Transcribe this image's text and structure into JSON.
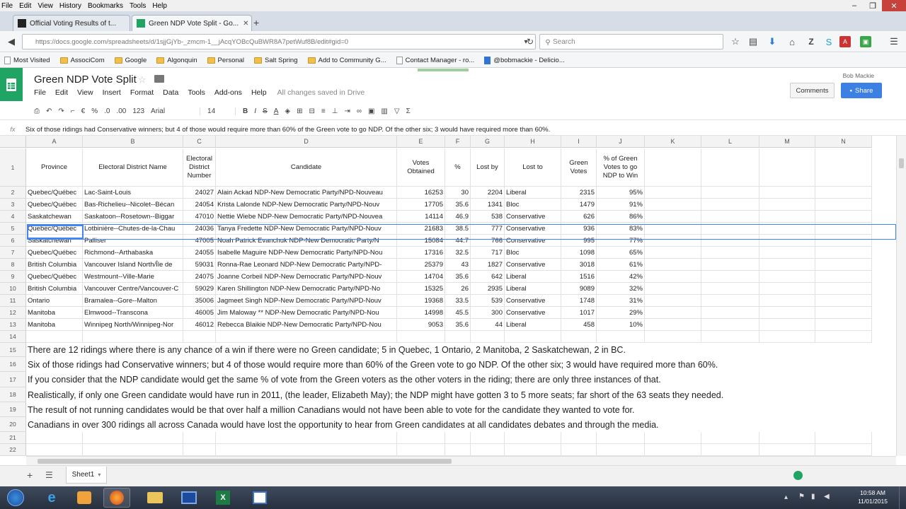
{
  "browser": {
    "menu": [
      "File",
      "Edit",
      "View",
      "History",
      "Bookmarks",
      "Tools",
      "Help"
    ],
    "tabs": [
      {
        "label": "Official Voting Results of t...",
        "active": false
      },
      {
        "label": "Green NDP Vote Split - Go...",
        "active": true
      }
    ],
    "new_tab": "+",
    "url": "https://docs.google.com/spreadsheets/d/1sjjGjYb-_zmcm-1__jAcqYOBcQuBWR8A7petWuf8B/edit#gid=0",
    "search_placeholder": "Search",
    "bookmarks": [
      {
        "label": "Most Visited",
        "type": "page"
      },
      {
        "label": "AssociCom",
        "type": "folder"
      },
      {
        "label": "Google",
        "type": "folder"
      },
      {
        "label": "Algonquin",
        "type": "folder"
      },
      {
        "label": "Personal",
        "type": "folder"
      },
      {
        "label": "Salt Spring",
        "type": "folder"
      },
      {
        "label": "Add to Community G...",
        "type": "folder"
      },
      {
        "label": "Contact Manager - ro...",
        "type": "page"
      },
      {
        "label": "@bobmackie - Delicio...",
        "type": "page"
      }
    ]
  },
  "sheet": {
    "title": "Green NDP Vote Split",
    "menu": [
      "File",
      "Edit",
      "View",
      "Insert",
      "Format",
      "Data",
      "Tools",
      "Add-ons",
      "Help"
    ],
    "saved_status": "All changes saved in Drive",
    "user": "Bob Mackie",
    "comments_label": "Comments",
    "share_label": "Share",
    "toolbar": {
      "currency": "€",
      "percent": "%",
      "dec_less": ".0",
      "dec_more": ".00",
      "more_formats": "123",
      "font": "Arial",
      "size": "14",
      "bold": "B",
      "italic": "I",
      "strike": "S",
      "color": "A",
      "sigma": "Σ"
    },
    "formula_prefix": "fx",
    "formula": "Six of those ridings had Conservative winners; but 4 of those would require more than 60% of the Green vote to go NDP. Of the other six; 3 would have required more than 60%.",
    "columns": [
      "A",
      "B",
      "C",
      "D",
      "E",
      "F",
      "G",
      "H",
      "I",
      "J",
      "K",
      "L",
      "M",
      "N"
    ],
    "headers": [
      "Province",
      "Electoral District Name",
      "Electoral District Number",
      "Candidate",
      "Votes Obtained",
      "%",
      "Lost by",
      "Lost to",
      "Green Votes",
      "% of Green Votes to go NDP to Win"
    ],
    "rows": [
      [
        "Quebec/Québec",
        "Lac-Saint-Louis",
        "24027",
        "Alain Ackad NDP-New Democratic Party/NPD-Nouveau",
        "16253",
        "30",
        "2204",
        "Liberal",
        "2315",
        "95%"
      ],
      [
        "Quebec/Québec",
        "Bas-Richelieu--Nicolet--Bécan",
        "24054",
        "Krista Lalonde NDP-New Democratic Party/NPD-Nouv",
        "17705",
        "35.6",
        "1341",
        "Bloc",
        "1479",
        "91%"
      ],
      [
        "Saskatchewan",
        "Saskatoon--Rosetown--Biggar",
        "47010",
        "Nettie Wiebe NDP-New Democratic Party/NPD-Nouvea",
        "14114",
        "46.9",
        "538",
        "Conservative",
        "626",
        "86%"
      ],
      [
        "Quebec/Québec",
        "Lotbinière--Chutes-de-la-Chau",
        "24036",
        "Tanya Fredette NDP-New Democratic Party/NPD-Nouv",
        "21683",
        "38.5",
        "777",
        "Conservative",
        "936",
        "83%"
      ],
      [
        "Saskatchewan",
        "Palliser",
        "47005",
        "Noah Patrick Evanchuk NDP-New Democratic Party/N",
        "15084",
        "44.7",
        "766",
        "Conservative",
        "995",
        "77%"
      ],
      [
        "Quebec/Québec",
        "Richmond--Arthabaska",
        "24055",
        "Isabelle Maguire NDP-New Democratic Party/NPD-Nou",
        "17316",
        "32.5",
        "717",
        "Bloc",
        "1098",
        "65%"
      ],
      [
        "British Columbia",
        "Vancouver Island North/Île de",
        "59031",
        "Ronna-Rae Leonard NDP-New Democratic Party/NPD-",
        "25379",
        "43",
        "1827",
        "Conservative",
        "3018",
        "61%"
      ],
      [
        "Quebec/Québec",
        "Westmount--Ville-Marie",
        "24075",
        "Joanne Corbeil NDP-New Democratic Party/NPD-Nouv",
        "14704",
        "35.6",
        "642",
        "Liberal",
        "1516",
        "42%"
      ],
      [
        "British Columbia",
        "Vancouver Centre/Vancouver-C",
        "59029",
        "Karen Shillington NDP-New Democratic Party/NPD-No",
        "15325",
        "26",
        "2935",
        "Liberal",
        "9089",
        "32%"
      ],
      [
        "Ontario",
        "Bramalea--Gore--Malton",
        "35006",
        "Jagmeet Singh NDP-New Democratic Party/NPD-Nouv",
        "19368",
        "33.5",
        "539",
        "Conservative",
        "1748",
        "31%"
      ],
      [
        "Manitoba",
        "Elmwood--Transcona",
        "46005",
        "Jim Maloway ** NDP-New Democratic Party/NPD-Nou",
        "14998",
        "45.5",
        "300",
        "Conservative",
        "1017",
        "29%"
      ],
      [
        "Manitoba",
        "Winnipeg North/Winnipeg-Nor",
        "46012",
        "Rebecca Blaikie NDP-New Democratic Party/NPD-Nou",
        "9053",
        "35.6",
        "44",
        "Liberal",
        "458",
        "10%"
      ]
    ],
    "notes": [
      {
        "row": "15",
        "text": "There are 12 ridings where there is any chance of a win if there were no Green candidate; 5 in Quebec, 1 Ontario, 2 Manitoba, 2 Saskatchewan, 2 in BC."
      },
      {
        "row": "16",
        "text": "Six of those ridings had Conservative winners; but 4 of those would require more than 60% of the Green vote to go NDP. Of the other six; 3 would have required more than 60%."
      },
      {
        "row": "17",
        "text": "If you consider that the NDP candidate would get the same % of vote from the Green voters as the other voters in the riding; there are only three instances of that."
      },
      {
        "row": "18",
        "text": "Realistically, if only one Green candidate would have run in 2011, (the leader, Elizabeth May); the NDP might have gotten 3 to 5 more seats; far short of the 63 seats they needed."
      },
      {
        "row": "19",
        "text": "The result of not running candidates would be that over half a million Canadians would not have been able to vote for the candidate they wanted to vote for."
      },
      {
        "row": "20",
        "text": "Canadians in over 300 ridings all across Canada would have lost the opportunity to hear from Green candidates at all candidates debates and through the media."
      }
    ],
    "row_numbers": [
      "1",
      "2",
      "3",
      "4",
      "5",
      "6",
      "7",
      "8",
      "9",
      "10",
      "11",
      "12",
      "13",
      "14",
      "15",
      "16",
      "17",
      "18",
      "19",
      "20",
      "21",
      "22"
    ],
    "sheet_tab": "Sheet1"
  },
  "taskbar": {
    "time": "10:58 AM",
    "date": "11/01/2015"
  },
  "colors": {
    "sheets_green": "#20a464",
    "share_blue": "#3d80e4",
    "selection_blue": "#4285f4"
  }
}
